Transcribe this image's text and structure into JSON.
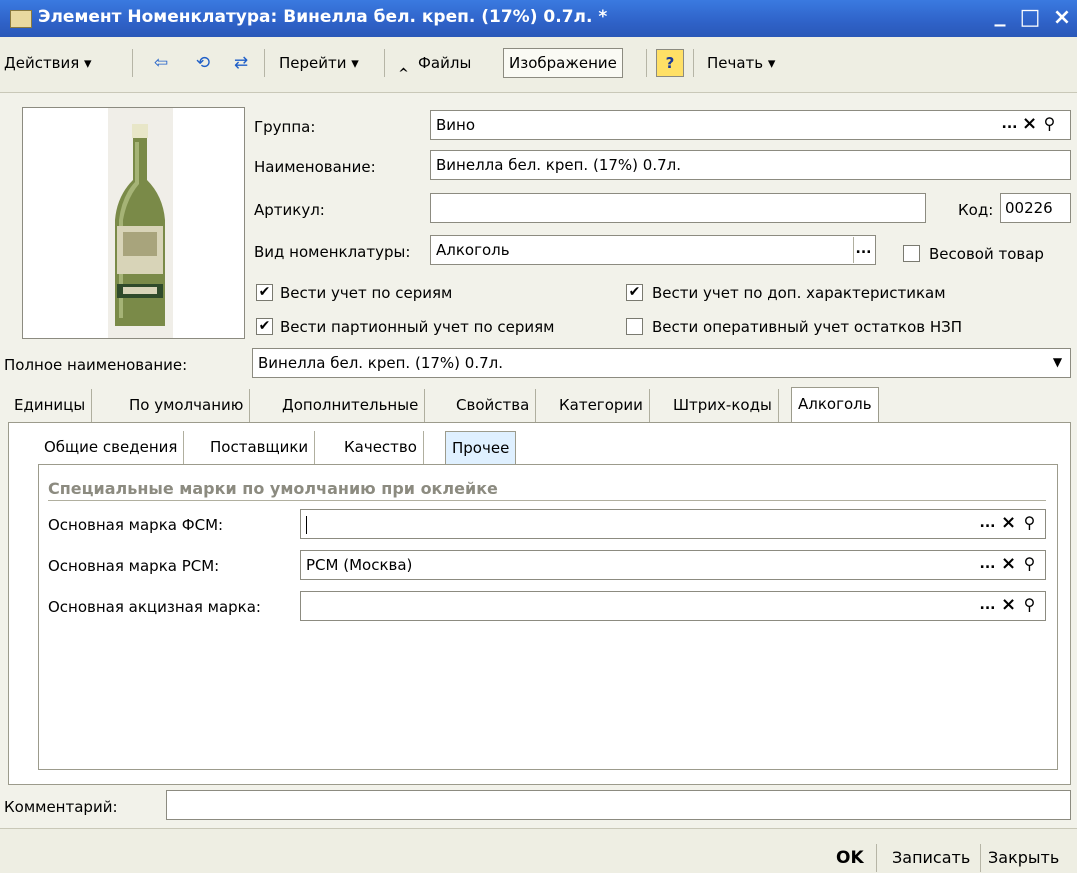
{
  "window": {
    "title": "Элемент Номенклатура: Винелла бел. креп. (17%) 0.7л. *",
    "minimize_glyph": "_",
    "maximize_glyph": "□",
    "close_glyph": "×"
  },
  "toolbar": {
    "actions": "Действия ▾",
    "goto": "Перейти ▾",
    "files": "Файлы",
    "image": "Изображение",
    "help": "?",
    "print": "Печать ▾",
    "icons": [
      "arrow-left-icon",
      "refresh-icon",
      "copy-icon",
      "paperclip-icon"
    ]
  },
  "header": {
    "group_label": "Группа:",
    "group_value": "Вино",
    "name_label": "Наименование:",
    "name_value": "Винелла бел. креп. (17%) 0.7л.",
    "article_label": "Артикул:",
    "article_value": "",
    "code_label": "Код:",
    "code_value": "00226",
    "kind_label": "Вид номенклатуры:",
    "kind_value": "Алкоголь",
    "weight_label": "Весовой товар",
    "weight_checked": false,
    "series_label": "Вести учет по сериям",
    "series_checked": true,
    "extchar_label": "Вести учет по доп.  характеристикам",
    "extchar_checked": true,
    "batch_label": "Вести партионный учет по сериям",
    "batch_checked": true,
    "nzp_label": "Вести оперативный учет остатков НЗП",
    "nzp_checked": false,
    "fullname_label": "Полное наименование:",
    "fullname_value": "Винелла бел. креп. (17%) 0.7л."
  },
  "tabs": [
    "Единицы",
    "По умолчанию",
    "Дополнительные",
    "Свойства",
    "Категории",
    "Штрих-коды",
    "Алкоголь"
  ],
  "active_tab": "Алкоголь",
  "subtabs": [
    "Общие сведения",
    "Поставщики",
    "Качество",
    "Прочее"
  ],
  "active_subtab": "Прочее",
  "section": {
    "title": "Специальные марки по умолчанию при оклейке",
    "fsm_label": "Основная марка ФСМ:",
    "fsm_value": "",
    "rsm_label": "Основная марка РСМ:",
    "rsm_value": "РСМ (Москва)",
    "excise_label": "Основная акцизная марка:",
    "excise_value": ""
  },
  "comment": {
    "label": "Комментарий:",
    "value": ""
  },
  "footer": {
    "ok": "OK",
    "save": "Записать",
    "close": "Закрыть"
  },
  "glyphs": {
    "ellipsis": "...",
    "clear": "×",
    "search": "⚲",
    "dropdown": "▼",
    "check": "✔"
  },
  "colors": {
    "title_bar": "#2f62c8",
    "window_bg": "#f2f2ea",
    "active_subtab": "#dff0ff",
    "help_bg": "#ffe066"
  }
}
